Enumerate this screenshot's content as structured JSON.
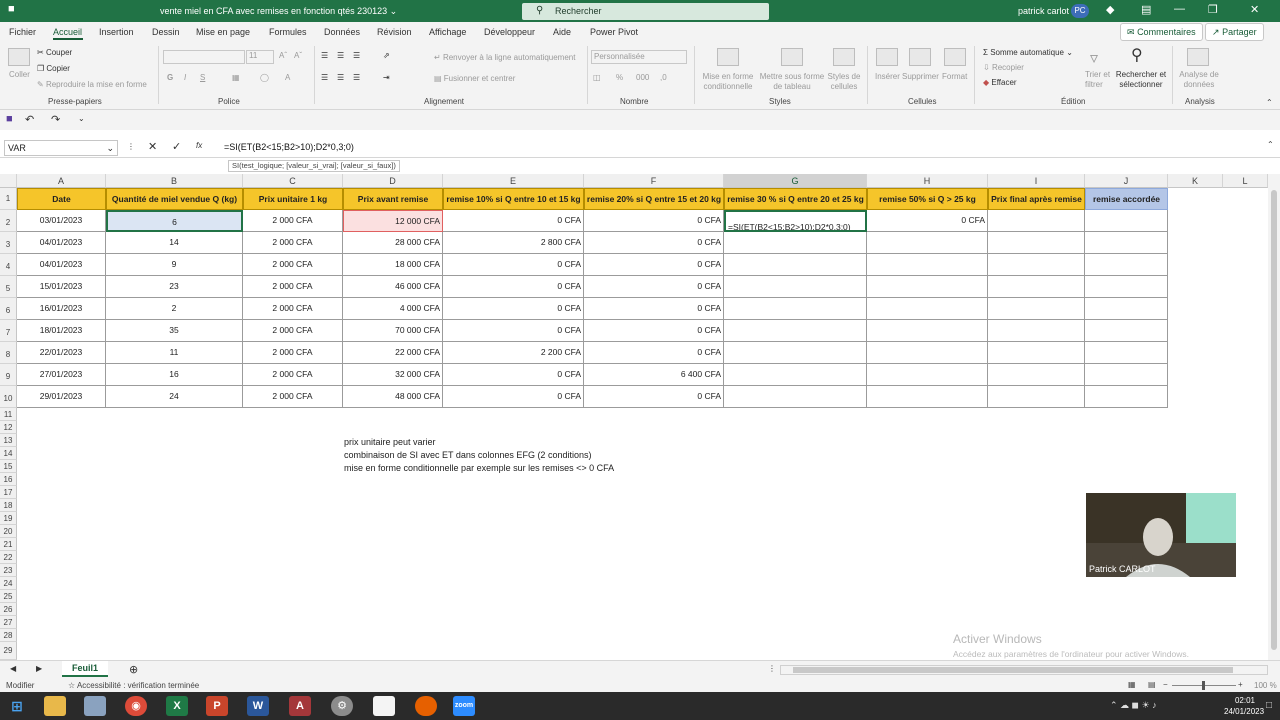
{
  "title_bar": {
    "document_title": "vente miel en CFA avec remises en fonction qtés 230123 ⌄",
    "search_label": "Rechercher",
    "user_name": "patrick carlot",
    "user_initials": "PC"
  },
  "menu": {
    "tabs": [
      "Fichier",
      "Accueil",
      "Insertion",
      "Dessin",
      "Mise en page",
      "Formules",
      "Données",
      "Révision",
      "Affichage",
      "Développeur",
      "Aide",
      "Power Pivot"
    ],
    "comments_label": "Commentaires",
    "share_label": "Partager"
  },
  "ribbon": {
    "paste": "Coller",
    "cut": "Couper",
    "copy": "Copier",
    "format_painter": "Reproduire la mise en forme",
    "font_size": "11",
    "bold": "G",
    "italic": "I",
    "underline": "S",
    "wrap_text": "Renvoyer à la ligne automatiquement",
    "merge_center": "Fusionner et centrer",
    "number_format": "Personnalisée",
    "conditional_format": "Mise en forme conditionnelle",
    "format_table": "Mettre sous forme de tableau",
    "cell_styles": "Styles de cellules",
    "insert": "Insérer",
    "delete": "Supprimer",
    "format": "Format",
    "autosum": "Somme automatique",
    "fill": "Recopier",
    "clear": "Effacer",
    "sort_filter": "Trier et filtrer",
    "find_select": "Rechercher et sélectionner",
    "analyze_data": "Analyse de données",
    "groups": [
      "Presse-papiers",
      "Police",
      "Alignement",
      "Nombre",
      "Styles",
      "Cellules",
      "Édition",
      "Analysis"
    ]
  },
  "formula_bar": {
    "name_box": "VAR",
    "fx": "fx",
    "formula": "=SI(ET(B2<15;B2>10);D2*0,3;0)",
    "tooltip": "SI(test_logique; [valeur_si_vrai]; [valeur_si_faux])"
  },
  "grid": {
    "columns": [
      "A",
      "B",
      "C",
      "D",
      "E",
      "F",
      "G",
      "H",
      "I",
      "J",
      "K",
      "L"
    ],
    "headers": [
      "Date",
      "Quantité de miel vendue Q (kg)",
      "Prix unitaire 1 kg",
      "Prix avant remise",
      "remise 10% si Q entre 10 et 15 kg",
      "remise 20% si Q entre 15 et 20 kg",
      "remise 30 % si Q entre 20 et 25 kg",
      "remise 50% si Q > 25 kg",
      "Prix final après remise",
      "remise accordée"
    ],
    "rows": [
      [
        "03/01/2023",
        "6",
        "2 000 CFA",
        "12 000 CFA",
        "0 CFA",
        "0 CFA",
        "=SI(ET(B2<15;B2>10);D2*0,3;0)",
        "0 CFA",
        "",
        ""
      ],
      [
        "04/01/2023",
        "14",
        "2 000 CFA",
        "28 000 CFA",
        "2 800 CFA",
        "0 CFA",
        "",
        "",
        "",
        ""
      ],
      [
        "04/01/2023",
        "9",
        "2 000 CFA",
        "18 000 CFA",
        "0 CFA",
        "0 CFA",
        "",
        "",
        "",
        ""
      ],
      [
        "15/01/2023",
        "23",
        "2 000 CFA",
        "46 000 CFA",
        "0 CFA",
        "0 CFA",
        "",
        "",
        "",
        ""
      ],
      [
        "16/01/2023",
        "2",
        "2 000 CFA",
        "4 000 CFA",
        "0 CFA",
        "0 CFA",
        "",
        "",
        "",
        ""
      ],
      [
        "18/01/2023",
        "35",
        "2 000 CFA",
        "70 000 CFA",
        "0 CFA",
        "0 CFA",
        "",
        "",
        "",
        ""
      ],
      [
        "22/01/2023",
        "11",
        "2 000 CFA",
        "22 000 CFA",
        "2 200 CFA",
        "0 CFA",
        "",
        "",
        "",
        ""
      ],
      [
        "27/01/2023",
        "16",
        "2 000 CFA",
        "32 000 CFA",
        "0 CFA",
        "6 400 CFA",
        "",
        "",
        "",
        ""
      ],
      [
        "29/01/2023",
        "24",
        "2 000 CFA",
        "48 000 CFA",
        "0 CFA",
        "0 CFA",
        "",
        "",
        "",
        ""
      ]
    ],
    "row_numbers": [
      "1",
      "2",
      "3",
      "4",
      "5",
      "6",
      "7",
      "8",
      "9",
      "10",
      "11",
      "12",
      "13",
      "14",
      "15",
      "16",
      "17",
      "18",
      "19",
      "20",
      "21",
      "22",
      "23",
      "24",
      "25",
      "26",
      "27",
      "28",
      "29"
    ],
    "notes": [
      "prix unitaire peut varier",
      "combinaison de SI avec ET dans colonnes EFG (2 conditions)",
      "mise en forme conditionnelle par exemple sur les remises <> 0 CFA"
    ]
  },
  "webcam": {
    "name": "Patrick CARLOT"
  },
  "watermark": {
    "title": "Activer Windows",
    "subtitle": "Accédez aux paramètres de l'ordinateur pour activer Windows."
  },
  "sheets": {
    "active": "Feuil1"
  },
  "status": {
    "mode": "Modifier",
    "accessibility": "Accessibilité : vérification terminée",
    "zoom": "100 %"
  },
  "taskbar": {
    "time": "02:01",
    "date": "24/01/2023"
  },
  "colors": {
    "title_green": "#217346",
    "header_yellow": "#f5c52a",
    "header_blue": "#b4c6e7"
  }
}
